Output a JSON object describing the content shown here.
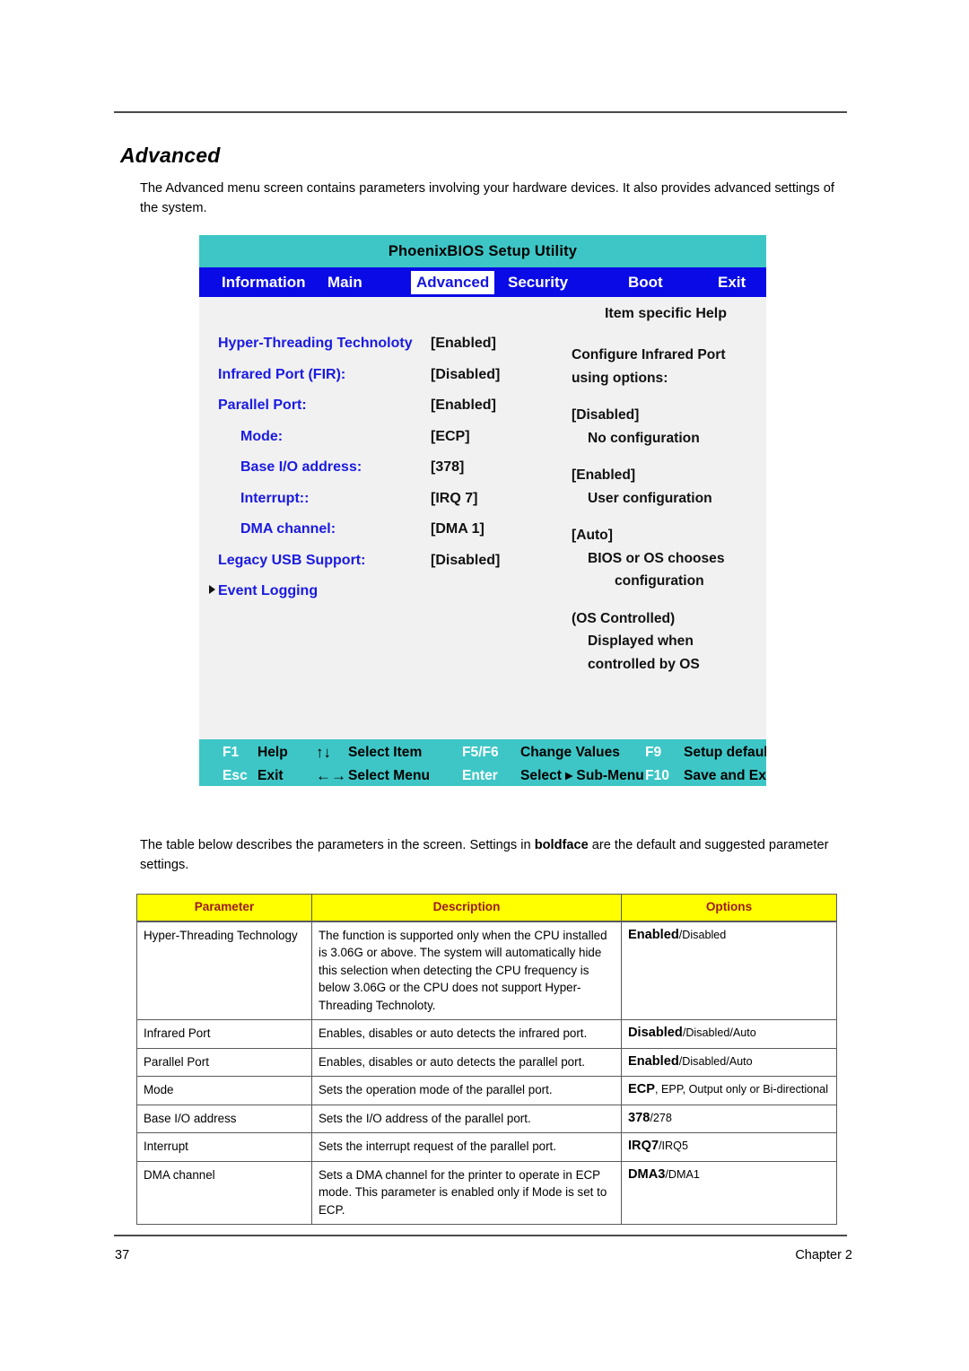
{
  "document": {
    "section_title": "Advanced",
    "intro_paragraph": "The Advanced menu screen contains parameters involving your hardware devices. It also provides advanced settings of the system.",
    "table_intro_before_bold": "The table below describes the parameters in the screen. Settings in ",
    "table_intro_bold": "boldface",
    "table_intro_after_bold": " are the default and suggested parameter settings.",
    "page_number": "37",
    "chapter_label": "Chapter 2"
  },
  "bios": {
    "title": "PhoenixBIOS Setup Utility",
    "menu": {
      "information": "Information",
      "main": "Main",
      "advanced": "Advanced",
      "security": "Security",
      "boot": "Boot",
      "exit": "Exit"
    },
    "help_header": "Item specific Help",
    "settings": [
      {
        "label": "Hyper-Threading Technoloty",
        "value": "[Enabled]",
        "indent": false,
        "submenu": false
      },
      {
        "label": "Infrared Port (FIR):",
        "value": "[Disabled]",
        "indent": false,
        "submenu": false
      },
      {
        "label": "Parallel Port:",
        "value": "[Enabled]",
        "indent": false,
        "submenu": false
      },
      {
        "label": "Mode:",
        "value": "[ECP]",
        "indent": true,
        "submenu": false
      },
      {
        "label": "Base I/O address:",
        "value": "[378]",
        "indent": true,
        "submenu": false
      },
      {
        "label": "Interrupt::",
        "value": "[IRQ 7]",
        "indent": true,
        "submenu": false
      },
      {
        "label": "DMA channel:",
        "value": "[DMA 1]",
        "indent": true,
        "submenu": false
      },
      {
        "label": "Legacy USB Support:",
        "value": "[Disabled]",
        "indent": false,
        "submenu": false
      },
      {
        "label": "Event Logging",
        "value": "",
        "indent": false,
        "submenu": true
      }
    ],
    "help_text": {
      "intro_line1": "Configure Infrared Port",
      "intro_line2": "using options:",
      "opt1_key": "[Disabled]",
      "opt1_desc": "No configuration",
      "opt2_key": "[Enabled]",
      "opt2_desc": "User configuration",
      "opt3_key": "[Auto]",
      "opt3_desc_line1": "BIOS or OS chooses",
      "opt3_desc_line2": "configuration",
      "opt4_key": "(OS Controlled)",
      "opt4_desc_line1": "Displayed when",
      "opt4_desc_line2": "controlled by OS"
    },
    "footer": {
      "row1": [
        {
          "key": "F1",
          "desc": "Help"
        },
        {
          "key": "↑↓",
          "desc": "Select Item"
        },
        {
          "key": "F5/F6",
          "desc": "Change Values"
        },
        {
          "key": "F9",
          "desc": "Setup defaults"
        }
      ],
      "row2": [
        {
          "key": "Esc",
          "desc": "Exit"
        },
        {
          "key": "←→",
          "desc": "Select Menu"
        },
        {
          "key": "Enter",
          "desc": "Select ▸ Sub-Menu"
        },
        {
          "key": "F10",
          "desc": "Save and Exit"
        }
      ]
    },
    "colors": {
      "title_bar": "#3ec6c6",
      "menu_bar": "#0a0ae6",
      "body": "#f1f1f1",
      "label_text": "#1a1ae0",
      "footer_bar": "#3ec6c6"
    }
  },
  "parameter_table": {
    "headers": [
      "Parameter",
      "Description",
      "Options"
    ],
    "header_bg": "#ffff00",
    "header_color": "#9c1a1a",
    "rows": [
      {
        "parameter": "Hyper-Threading Technology",
        "description": "The function is supported only when the CPU installed is 3.06G or above. The system will automatically hide this selection when detecting the CPU frequency is below 3.06G or the CPU does not support Hyper-Threading Technoloty.",
        "option_default": "Enabled",
        "option_rest": "/Disabled"
      },
      {
        "parameter": "Infrared Port",
        "description": "Enables, disables or auto detects the infrared port.",
        "option_default": "Disabled",
        "option_rest": "/Disabled/Auto"
      },
      {
        "parameter": "Parallel Port",
        "description": "Enables, disables or auto detects the parallel port.",
        "option_default": "Enabled",
        "option_rest": "/Disabled/Auto"
      },
      {
        "parameter": "Mode",
        "description": "Sets the operation mode of the parallel port.",
        "option_default": "ECP",
        "option_rest": ", EPP, Output only or Bi-directional"
      },
      {
        "parameter": "Base I/O address",
        "description": "Sets the I/O address of the parallel port.",
        "option_default": "378",
        "option_rest": "/278"
      },
      {
        "parameter": "Interrupt",
        "description": "Sets the interrupt request of the parallel port.",
        "option_default": "IRQ7",
        "option_rest": "/IRQ5"
      },
      {
        "parameter": "DMA channel",
        "description": "Sets a DMA channel for the printer to operate in ECP mode. This parameter is enabled only if Mode is set to ECP.",
        "option_default": "DMA3",
        "option_rest": "/DMA1"
      }
    ]
  }
}
